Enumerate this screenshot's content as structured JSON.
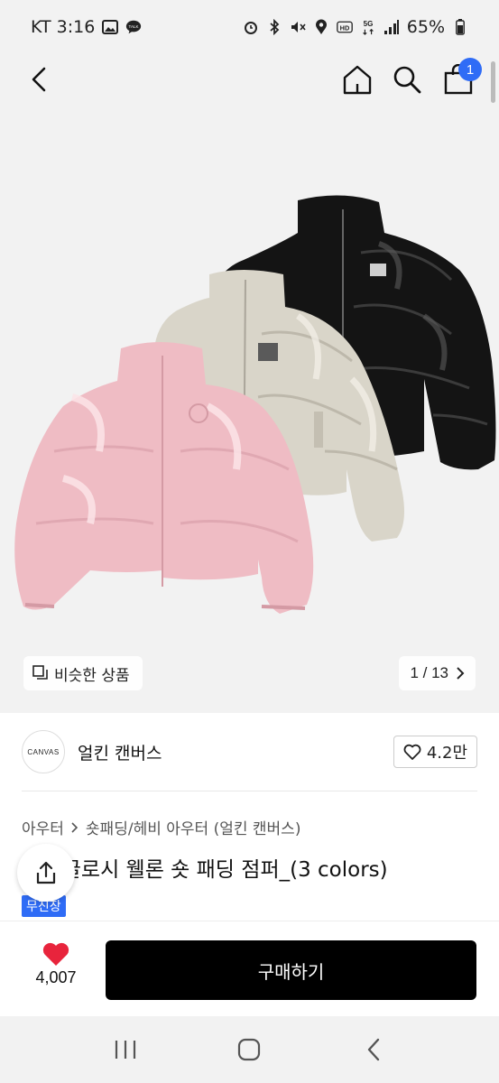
{
  "status_bar": {
    "carrier_time": "KT 3:16",
    "battery": "65%",
    "icons": [
      "gallery-icon",
      "talk-icon",
      "alarm-icon",
      "bluetooth-icon",
      "mute-icon",
      "location-icon",
      "hd-icon",
      "5g-icon",
      "signal-icon",
      "battery-icon"
    ]
  },
  "nav": {
    "cart_count": "1",
    "icons": [
      "back-icon",
      "home-icon",
      "search-icon",
      "cart-icon"
    ]
  },
  "gallery": {
    "similar_label": "비슷한 상품",
    "pager_text": "1 / 13",
    "colors": {
      "black_jacket": "#121212",
      "beige_jacket": "#d9d5c9",
      "pink_jacket": "#efbcc4"
    }
  },
  "brand": {
    "logo_text": "CANVAS",
    "name": "얼킨 캔버스",
    "likes": "4.2만"
  },
  "product": {
    "breadcrumb": [
      "아우터",
      "숏패딩/헤비 아우터 (얼킨 캔버스)"
    ],
    "title": "[ 출 글로시 웰론 숏 패딩 점퍼_(3 colors)",
    "badge": "무진장"
  },
  "buy_bar": {
    "wish_count": "4,007",
    "buy_label": "구매하기"
  },
  "colors": {
    "accent": "#2f6cf6",
    "heart": "#e8243c",
    "buy_button": "#000000"
  }
}
